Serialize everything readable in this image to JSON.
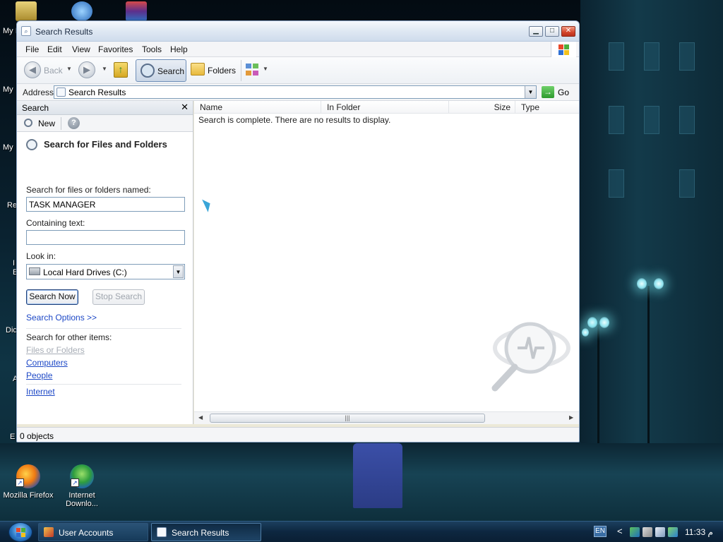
{
  "desktop": {
    "icons": [
      {
        "label": "Mozilla Firefox"
      },
      {
        "label": "Internet Downlo..."
      }
    ],
    "edge_labels": [
      "My I",
      "My",
      "My",
      "Re",
      "I",
      "E",
      "Dic",
      "A",
      "E"
    ]
  },
  "window": {
    "title": "Search Results",
    "controls": {
      "minimize": "▁",
      "maximize": "□",
      "close": "✕"
    },
    "menu": [
      "File",
      "Edit",
      "View",
      "Favorites",
      "Tools",
      "Help"
    ],
    "toolbar": {
      "back_label": "Back",
      "search_label": "Search",
      "folders_label": "Folders"
    },
    "address": {
      "label": "Address",
      "value": "Search Results",
      "go_label": "Go"
    },
    "search_pane": {
      "title": "Search",
      "new_label": "New",
      "heading": "Search for Files and Folders",
      "named_label": "Search for files or folders named:",
      "named_value": "TASK MANAGER",
      "containing_label": "Containing text:",
      "containing_value": "",
      "look_in_label": "Look in:",
      "look_in_value": "Local Hard Drives (C:)",
      "search_now_label": "Search Now",
      "stop_search_label": "Stop Search",
      "search_options_link": "Search Options  >>",
      "other_items_label": "Search for other items:",
      "other_items": [
        {
          "label": "Files or Folders",
          "enabled": false
        },
        {
          "label": "Computers",
          "enabled": true
        },
        {
          "label": "People",
          "enabled": true
        }
      ],
      "internet_link": "Internet"
    },
    "results": {
      "columns": [
        "Name",
        "In Folder",
        "Size",
        "Type"
      ],
      "message": "Search is complete. There are no results to display."
    },
    "status": "0 objects"
  },
  "taskbar": {
    "buttons": [
      {
        "label": "User Accounts",
        "active": false
      },
      {
        "label": "Search Results",
        "active": true
      }
    ],
    "tray": {
      "language": "EN",
      "chevron": "<",
      "clock": "11:33 م"
    }
  },
  "colors": {
    "link": "#1d48c6",
    "link_disabled": "#a7adb6",
    "window_frame": "#8aa5c8",
    "taskbar": "#0d2740"
  }
}
